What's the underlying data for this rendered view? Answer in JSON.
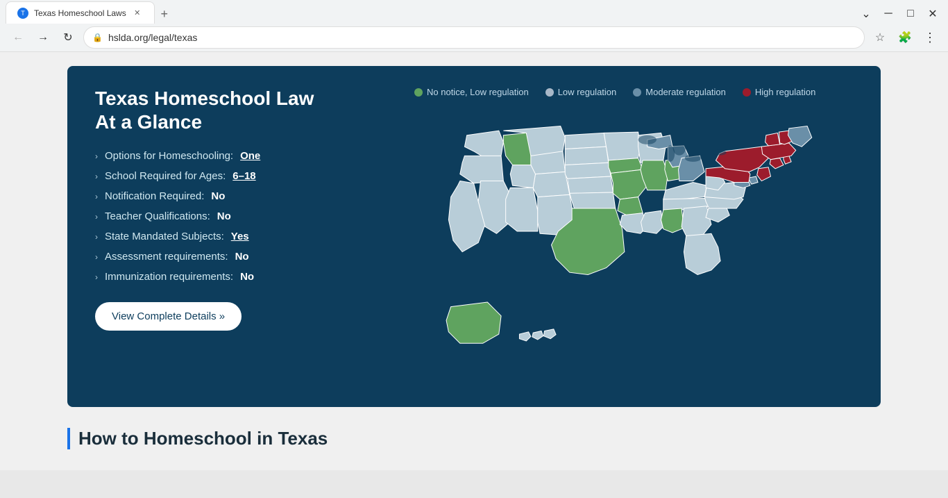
{
  "browser": {
    "tab_title": "Texas Homeschool Laws",
    "tab_favicon": "T",
    "url": "hslda.org/legal/texas",
    "new_tab_label": "+"
  },
  "legend": [
    {
      "id": "no-notice-low",
      "label": "No notice, Low regulation",
      "color": "#5fa35f"
    },
    {
      "id": "low",
      "label": "Low regulation",
      "color": "#a8b8c8"
    },
    {
      "id": "moderate",
      "label": "Moderate regulation",
      "color": "#6a8fa8"
    },
    {
      "id": "high",
      "label": "High regulation",
      "color": "#9c1c2c"
    }
  ],
  "card": {
    "title_line1": "Texas Homeschool Law",
    "title_line2": "At a Glance",
    "view_btn_label": "View Complete Details »"
  },
  "info_items": [
    {
      "label": "Options for Homeschooling:",
      "value": "One",
      "underline": true
    },
    {
      "label": "School Required for Ages:",
      "value": "6–18",
      "underline": true
    },
    {
      "label": "Notification Required:",
      "value": "No",
      "underline": false
    },
    {
      "label": "Teacher Qualifications:",
      "value": "No",
      "underline": false
    },
    {
      "label": "State Mandated Subjects:",
      "value": "Yes",
      "underline": true
    },
    {
      "label": "Assessment requirements:",
      "value": "No",
      "underline": false
    },
    {
      "label": "Immunization requirements:",
      "value": "No",
      "underline": false
    }
  ],
  "how_section": {
    "title": "How to Homeschool in Texas"
  },
  "colors": {
    "dark_blue": "#0d3d5c",
    "light_blue": "#a8b8c8",
    "mid_blue": "#6a8fa8",
    "green": "#5fa35f",
    "red": "#9c1c2c",
    "state_default": "#b8cdd8"
  }
}
